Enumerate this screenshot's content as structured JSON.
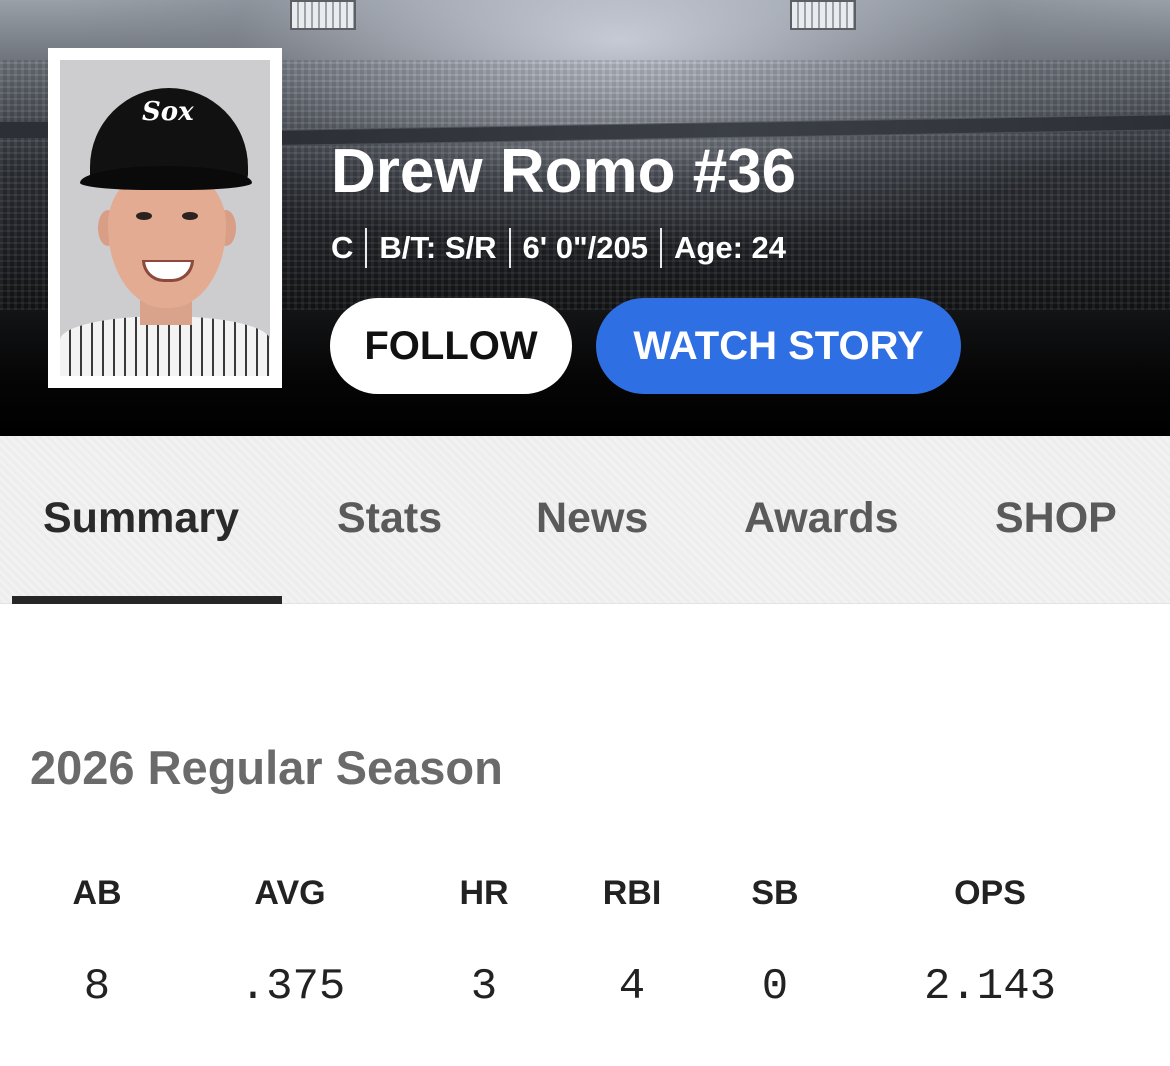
{
  "player": {
    "name": "Drew Romo #36",
    "position": "C",
    "bats_throws": "B/T: S/R",
    "height_weight": "6' 0\"/205",
    "age": "Age: 24",
    "cap_logo": "Sox"
  },
  "actions": {
    "follow_label": "FOLLOW",
    "watch_label": "WATCH STORY"
  },
  "tabs": [
    {
      "label": "Summary"
    },
    {
      "label": "Stats"
    },
    {
      "label": "News"
    },
    {
      "label": "Awards"
    },
    {
      "label": "SHOP"
    }
  ],
  "season": {
    "title": "2026 Regular Season",
    "stats": [
      {
        "label": "AB",
        "value": "8"
      },
      {
        "label": "AVG",
        "value": ".375"
      },
      {
        "label": "HR",
        "value": "3"
      },
      {
        "label": "RBI",
        "value": "4"
      },
      {
        "label": "SB",
        "value": "0"
      },
      {
        "label": "OPS",
        "value": "2.143"
      }
    ]
  },
  "colors": {
    "accent": "#2f6fe4",
    "hero_bg": "#000000",
    "tab_bg": "#f2f2f2"
  }
}
